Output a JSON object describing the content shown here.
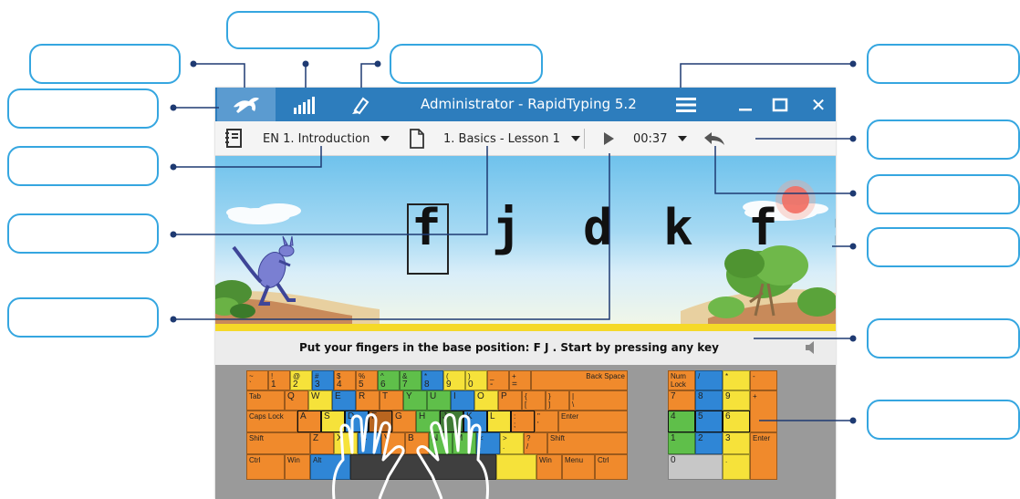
{
  "window": {
    "title": "Administrator - RapidTyping 5.2",
    "close_glyph": "✕"
  },
  "toolbar": {
    "course_label": "EN 1. Introduction",
    "lesson_label": "1. Basics - Lesson 1",
    "timer": "00:37"
  },
  "exercise": {
    "letters": [
      "f",
      "j",
      "d",
      "k",
      "f",
      ":"
    ]
  },
  "status": {
    "text": "Put your fingers in the base position:  F  J .  Start by pressing any key"
  },
  "icons": {
    "tutor": "running-animal-icon",
    "statistics": "statistics-bars-icon",
    "editor": "pen-editor-icon",
    "menu": "hamburger-menu-icon",
    "course": "course-book-icon",
    "lesson": "lesson-page-icon",
    "play": "play-icon",
    "undo": "undo-arrow-icon",
    "sound": "speaker-icon"
  },
  "colors": {
    "titlebar": "#2d7dbd",
    "callout_border": "#35a6e0",
    "leader_line": "#1e3a72",
    "key_orange": "#f08a2c",
    "key_yellow": "#f6e23a",
    "key_blue": "#2f86d6",
    "key_green": "#5fbf4a"
  },
  "keyboard": {
    "row1": [
      {
        "top": "~",
        "bot": "`"
      },
      {
        "top": "!",
        "bot": "1"
      },
      {
        "top": "@",
        "bot": "2"
      },
      {
        "top": "#",
        "bot": "3"
      },
      {
        "top": "$",
        "bot": "4"
      },
      {
        "top": "%",
        "bot": "5"
      },
      {
        "top": "^",
        "bot": "6"
      },
      {
        "top": "&",
        "bot": "7"
      },
      {
        "top": "*",
        "bot": "8"
      },
      {
        "top": "(",
        "bot": "9"
      },
      {
        "top": ")",
        "bot": "0"
      },
      {
        "top": "_",
        "bot": "-"
      },
      {
        "top": "+",
        "bot": "="
      }
    ],
    "backspace": "Back Space",
    "tab": "Tab",
    "row2": [
      "Q",
      "W",
      "E",
      "R",
      "T",
      "Y",
      "U",
      "I",
      "O",
      "P"
    ],
    "row2_br": [
      {
        "top": "{",
        "bot": "["
      },
      {
        "top": "}",
        "bot": "]"
      },
      {
        "top": "|",
        "bot": "\\"
      }
    ],
    "caps": "Caps Lock",
    "row3": [
      "A",
      "S",
      "D",
      "F",
      "G",
      "H",
      "J",
      "K",
      "L"
    ],
    "row3_punct": [
      {
        "top": ":",
        "bot": ";"
      },
      {
        "top": "\"",
        "bot": "'"
      }
    ],
    "enter": "Enter",
    "shift": "Shift",
    "row4": [
      "Z",
      "X",
      "C",
      "V",
      "B",
      "N",
      "M"
    ],
    "row4_punct": [
      {
        "top": "<",
        "bot": ","
      },
      {
        "top": ">",
        "bot": "."
      },
      {
        "top": "?",
        "bot": "/"
      }
    ],
    "ctrl": "Ctrl",
    "win": "Win",
    "alt": "Alt",
    "menu": "Menu",
    "numpad": {
      "numlock": "Num Lock",
      "slash": "/",
      "star": "*",
      "minus": "-",
      "plus": "+",
      "n7": "7",
      "n8": "8",
      "n9": "9",
      "n4": "4",
      "n5": "5",
      "n6": "6",
      "n1": "1",
      "n2": "2",
      "n3": "3",
      "n0": "0",
      "dot": ".",
      "enter": "Enter"
    }
  }
}
